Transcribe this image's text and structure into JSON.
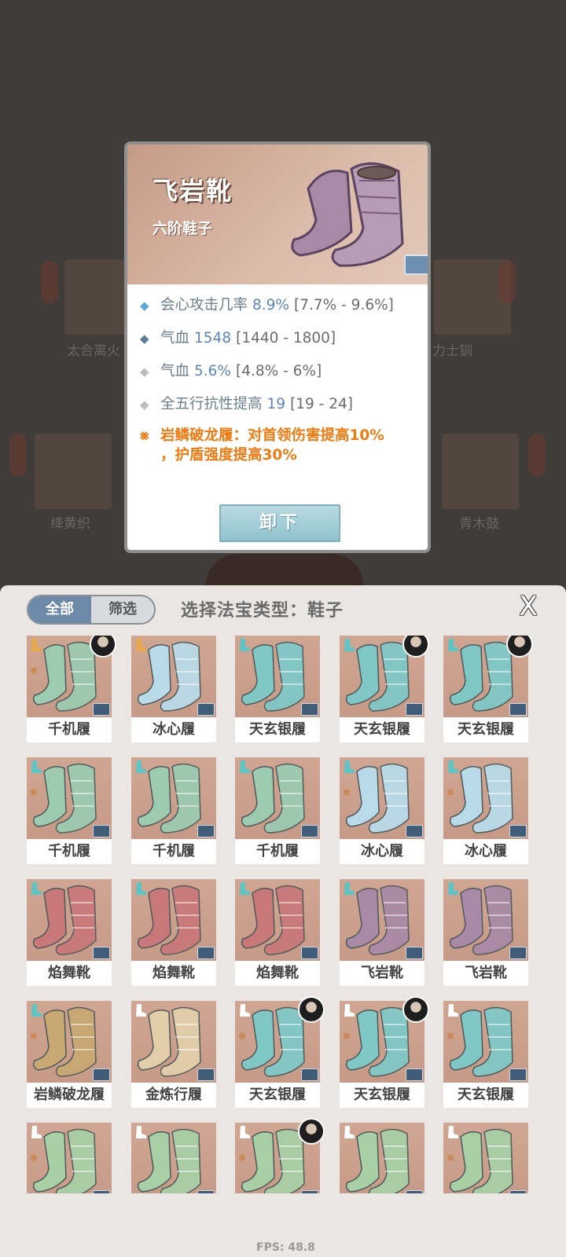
{
  "popup": {
    "title": "飞岩靴",
    "subtitle": "六阶鞋子",
    "stats": [
      {
        "name": "会心攻击几率",
        "value": "8.9%",
        "range": "[7.7% - 9.6%]",
        "bullet_color": "#5aa8d6"
      },
      {
        "name": "气血",
        "value": "1548",
        "range": "[1440 - 1800]",
        "bullet_color": "#5d7a99"
      },
      {
        "name": "气血",
        "value": "5.6%",
        "range": "[4.8% - 6%]",
        "bullet_color": "#bdbdbd"
      },
      {
        "name": "全五行抗性提高",
        "value": "19",
        "range": "[19 - 24]",
        "bullet_color": "#bdbdbd"
      }
    ],
    "set_effect": "岩鳞破龙履：对首领伤害提高10%，护盾强度提高30%",
    "set_effect_line1": "岩鳞破龙履：对首领伤害提高10%",
    "set_effect_line2": "，护盾强度提高30%",
    "unequip_label": "卸下"
  },
  "panel": {
    "tabs": [
      "全部",
      "筛选"
    ],
    "title": "选择法宝类型：鞋子",
    "close_label": "X"
  },
  "items": [
    {
      "name": "千机履",
      "theme": "green",
      "avatar": true,
      "slot_color": "#e8a94a",
      "set": true
    },
    {
      "name": "冰心履",
      "theme": "ice",
      "avatar": false,
      "slot_color": "#e8a94a",
      "set": false
    },
    {
      "name": "天玄银履",
      "theme": "teal",
      "avatar": false,
      "slot_color": "#5cc6c6",
      "set": false
    },
    {
      "name": "天玄银履",
      "theme": "teal",
      "avatar": true,
      "slot_color": "#5cc6c6",
      "set": false
    },
    {
      "name": "天玄银履",
      "theme": "teal",
      "avatar": true,
      "slot_color": "#5cc6c6",
      "set": false
    },
    {
      "name": "千机履",
      "theme": "green",
      "avatar": false,
      "slot_color": "#5cc6c6",
      "set": true
    },
    {
      "name": "千机履",
      "theme": "green",
      "avatar": false,
      "slot_color": "#5cc6c6",
      "set": false
    },
    {
      "name": "千机履",
      "theme": "green",
      "avatar": false,
      "slot_color": "#5cc6c6",
      "set": false
    },
    {
      "name": "冰心履",
      "theme": "ice",
      "avatar": false,
      "slot_color": "#5cc6c6",
      "set": true
    },
    {
      "name": "冰心履",
      "theme": "ice",
      "avatar": false,
      "slot_color": "#5cc6c6",
      "set": true
    },
    {
      "name": "焰舞靴",
      "theme": "red",
      "avatar": false,
      "slot_color": "#5cc6c6",
      "set": false
    },
    {
      "name": "焰舞靴",
      "theme": "red",
      "avatar": false,
      "slot_color": "#5cc6c6",
      "set": false
    },
    {
      "name": "焰舞靴",
      "theme": "red",
      "avatar": false,
      "slot_color": "#5cc6c6",
      "set": false
    },
    {
      "name": "飞岩靴",
      "theme": "purple",
      "avatar": false,
      "slot_color": "#5cc6c6",
      "set": false
    },
    {
      "name": "飞岩靴",
      "theme": "purple",
      "avatar": false,
      "slot_color": "#5cc6c6",
      "set": false
    },
    {
      "name": "岩鳞破龙履",
      "theme": "gold",
      "avatar": false,
      "slot_color": "#5cc6c6",
      "set": true
    },
    {
      "name": "金炼行履",
      "theme": "cream",
      "avatar": false,
      "slot_color": "#ffffff",
      "set": false
    },
    {
      "name": "天玄银履",
      "theme": "teal",
      "avatar": true,
      "slot_color": "#ffffff",
      "set": true
    },
    {
      "name": "天玄银履",
      "theme": "teal",
      "avatar": true,
      "slot_color": "#ffffff",
      "set": true
    },
    {
      "name": "天玄银履",
      "theme": "teal",
      "avatar": false,
      "slot_color": "#ffffff",
      "set": true
    },
    {
      "name": "",
      "theme": "lime",
      "avatar": false,
      "slot_color": "#ffffff",
      "set": true
    },
    {
      "name": "",
      "theme": "lime",
      "avatar": false,
      "slot_color": "#ffffff",
      "set": false
    },
    {
      "name": "",
      "theme": "lime",
      "avatar": true,
      "slot_color": "#ffffff",
      "set": true
    },
    {
      "name": "",
      "theme": "lime",
      "avatar": false,
      "slot_color": "#ffffff",
      "set": false
    },
    {
      "name": "",
      "theme": "lime",
      "avatar": false,
      "slot_color": "#ffffff",
      "set": true
    }
  ],
  "themes": {
    "green": "#9ccbb0",
    "ice": "#b9dbe9",
    "teal": "#7fc8c6",
    "red": "#c9787a",
    "purple": "#a98aa6",
    "gold": "#c8a872",
    "cream": "#e2cfaa",
    "lime": "#a9cfa6"
  },
  "background": {
    "labels": [
      "太合离火",
      "力士钏",
      "绛黄织",
      "青木鼓"
    ]
  },
  "fps": "FPS: 48.8"
}
